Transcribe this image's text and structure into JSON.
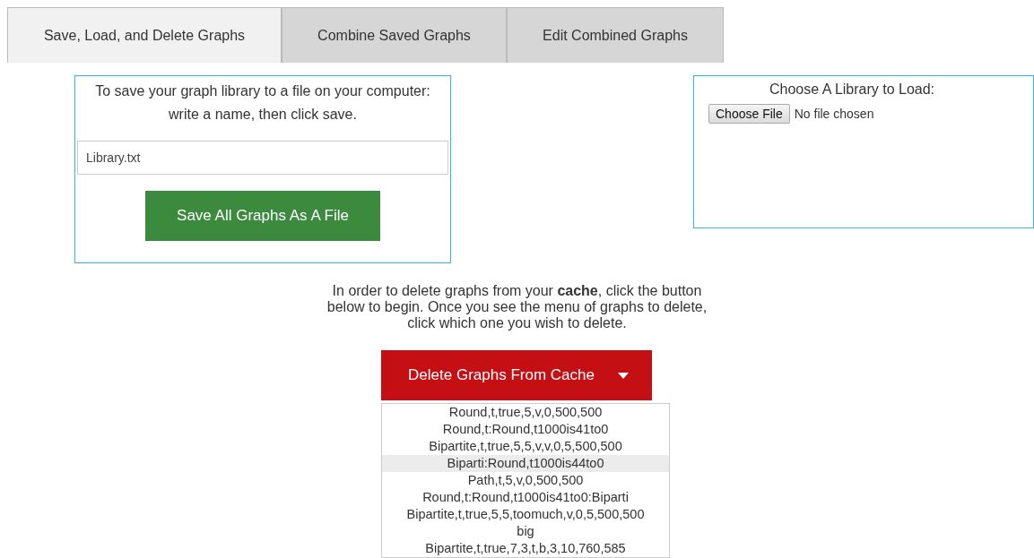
{
  "tabs": [
    {
      "label": "Save, Load, and Delete Graphs",
      "selected": true
    },
    {
      "label": "Combine Saved Graphs",
      "selected": false
    },
    {
      "label": "Edit Combined Graphs",
      "selected": false
    }
  ],
  "save_panel": {
    "instructions": [
      "To save your graph library to a file on your computer:",
      "write a name, then click save."
    ],
    "filename": "Library.txt",
    "save_button": "Save All Graphs As A File"
  },
  "load_panel": {
    "title": "Choose A Library to Load:",
    "choose_button": "Choose File",
    "file_status": "No file chosen"
  },
  "delete_section": {
    "instructions": "In order to delete graphs from your **cache**, click the button below to begin. Once you see the menu of graphs to delete, click which one you wish to delete.",
    "dropdown_button": "Delete Graphs From Cache",
    "menu_items": [
      {
        "label": "Round,t,true,5,v,0,500,500",
        "selected": false
      },
      {
        "label": "Round,t:Round,t1000is41to0",
        "selected": false
      },
      {
        "label": "Bipartite,t,true,5,5,v,v,0,5,500,500",
        "selected": false
      },
      {
        "label": "Biparti:Round,t1000is44to0",
        "selected": true
      },
      {
        "label": "Path,t,5,v,0,500,500",
        "selected": false
      },
      {
        "label": "Round,t:Round,t1000is41to0:Biparti",
        "selected": false
      },
      {
        "label": "Bipartite,t,true,5,5,toomuch,v,0,5,500,500",
        "selected": false
      },
      {
        "label": "big",
        "selected": false
      },
      {
        "label": "Bipartite,t,true,7,3,t,b,3,10,760,585",
        "selected": false
      }
    ]
  }
}
